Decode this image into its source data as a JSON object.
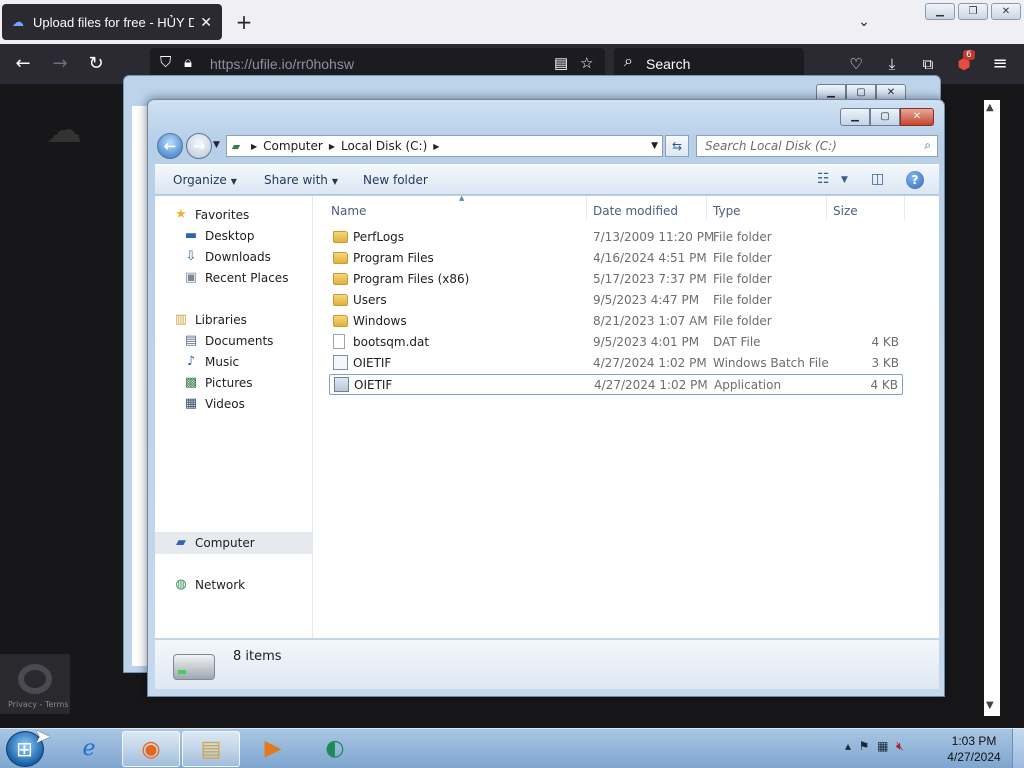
{
  "browser": {
    "tab_title": "Upload files for free - HỦY DIỆT",
    "url": "https://ufile.io/rr0hohsw",
    "search_placeholder": "Search",
    "extension_badge": "6"
  },
  "explorer": {
    "breadcrumb": [
      "Computer",
      "Local Disk (C:)"
    ],
    "search_placeholder": "Search Local Disk (C:)",
    "toolbar": {
      "organize": "Organize",
      "share_with": "Share with",
      "new_folder": "New folder"
    },
    "nav": {
      "favorites": "Favorites",
      "desktop": "Desktop",
      "downloads": "Downloads",
      "recent_places": "Recent Places",
      "libraries": "Libraries",
      "documents": "Documents",
      "music": "Music",
      "pictures": "Pictures",
      "videos": "Videos",
      "computer": "Computer",
      "network": "Network"
    },
    "columns": {
      "name": "Name",
      "date_modified": "Date modified",
      "type": "Type",
      "size": "Size"
    },
    "files": [
      {
        "name": "PerfLogs",
        "date": "7/13/2009 11:20 PM",
        "type": "File folder",
        "size": "",
        "icon": "folder-icon"
      },
      {
        "name": "Program Files",
        "date": "4/16/2024 4:51 PM",
        "type": "File folder",
        "size": "",
        "icon": "folder-icon"
      },
      {
        "name": "Program Files (x86)",
        "date": "5/17/2023 7:37 PM",
        "type": "File folder",
        "size": "",
        "icon": "folder-icon"
      },
      {
        "name": "Users",
        "date": "9/5/2023 4:47 PM",
        "type": "File folder",
        "size": "",
        "icon": "folder-icon"
      },
      {
        "name": "Windows",
        "date": "8/21/2023 1:07 AM",
        "type": "File folder",
        "size": "",
        "icon": "folder-icon"
      },
      {
        "name": "bootsqm.dat",
        "date": "9/5/2023 4:01 PM",
        "type": "DAT File",
        "size": "4 KB",
        "icon": "document-icon"
      },
      {
        "name": "OIETIF",
        "date": "4/27/2024 1:02 PM",
        "type": "Windows Batch File",
        "size": "3 KB",
        "icon": "batch-file-icon"
      },
      {
        "name": "OIETIF",
        "date": "4/27/2024 1:02 PM",
        "type": "Application",
        "size": "4 KB",
        "icon": "application-icon"
      }
    ],
    "status": "8 items"
  },
  "taskbar": {
    "time": "1:03 PM",
    "date": "4/27/2024"
  },
  "recaptcha_text": "Privacy - Terms"
}
